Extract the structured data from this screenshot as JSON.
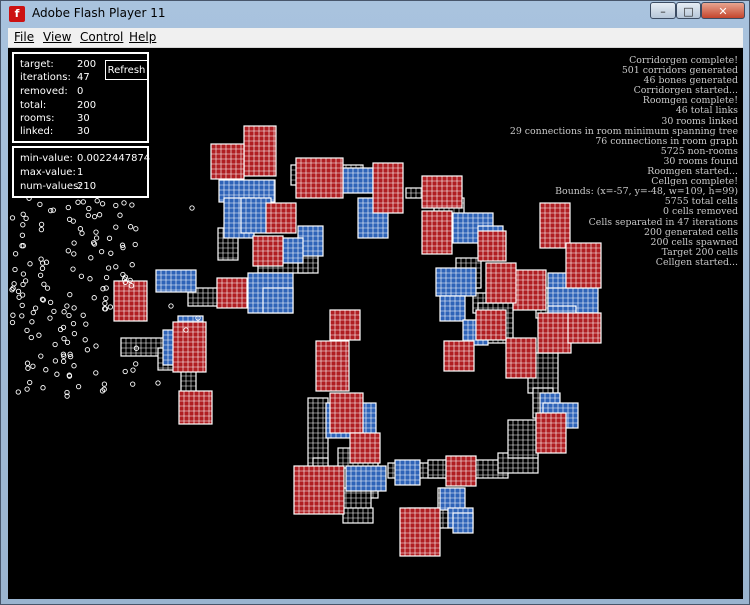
{
  "window": {
    "title": "Adobe Flash Player 11",
    "icon": "flash-player-icon",
    "minimize": "–",
    "maximize": "□",
    "close": "✕"
  },
  "menu": {
    "items": [
      {
        "label": "File",
        "name": "menu-file"
      },
      {
        "label": "View",
        "name": "menu-view"
      },
      {
        "label": "Control",
        "name": "menu-control"
      },
      {
        "label": "Help",
        "name": "menu-help"
      }
    ]
  },
  "stats": {
    "rows": [
      {
        "label": "target:",
        "value": "200"
      },
      {
        "label": "iterations:",
        "value": "47"
      },
      {
        "label": "removed:",
        "value": "0"
      },
      {
        "label": "total:",
        "value": "200"
      },
      {
        "label": "rooms:",
        "value": "30"
      },
      {
        "label": "linked:",
        "value": "30"
      }
    ],
    "refresh_label": "Refresh"
  },
  "values": {
    "rows": [
      {
        "label": "min-value:",
        "value": "0.0022447874"
      },
      {
        "label": "max-value:",
        "value": "1"
      },
      {
        "label": "num-values:",
        "value": "210"
      }
    ]
  },
  "log": [
    "Corridorgen complete!",
    "501 corridors generated",
    "46 bones generated",
    "Corridorgen started...",
    "Roomgen complete!",
    "46 total links",
    "30 rooms linked",
    "29 connections in room minimum spanning tree",
    "76 connections in room graph",
    "5725 non-rooms",
    "30 rooms found",
    "Roomgen started...",
    "Cellgen complete!",
    "Bounds: (x=-57, y=-48, w=109, h=99)",
    "5755 total cells",
    "0 cells removed",
    "Cells separated in 47 iterations",
    "200 generated cells",
    "200 cells spawned",
    "Target 200 cells",
    "Cellgen started..."
  ],
  "colors": {
    "room": "#b01e22",
    "link": "#2e63b8",
    "corridor": "#000000",
    "grid": "#ffffff",
    "background": "#000000"
  }
}
